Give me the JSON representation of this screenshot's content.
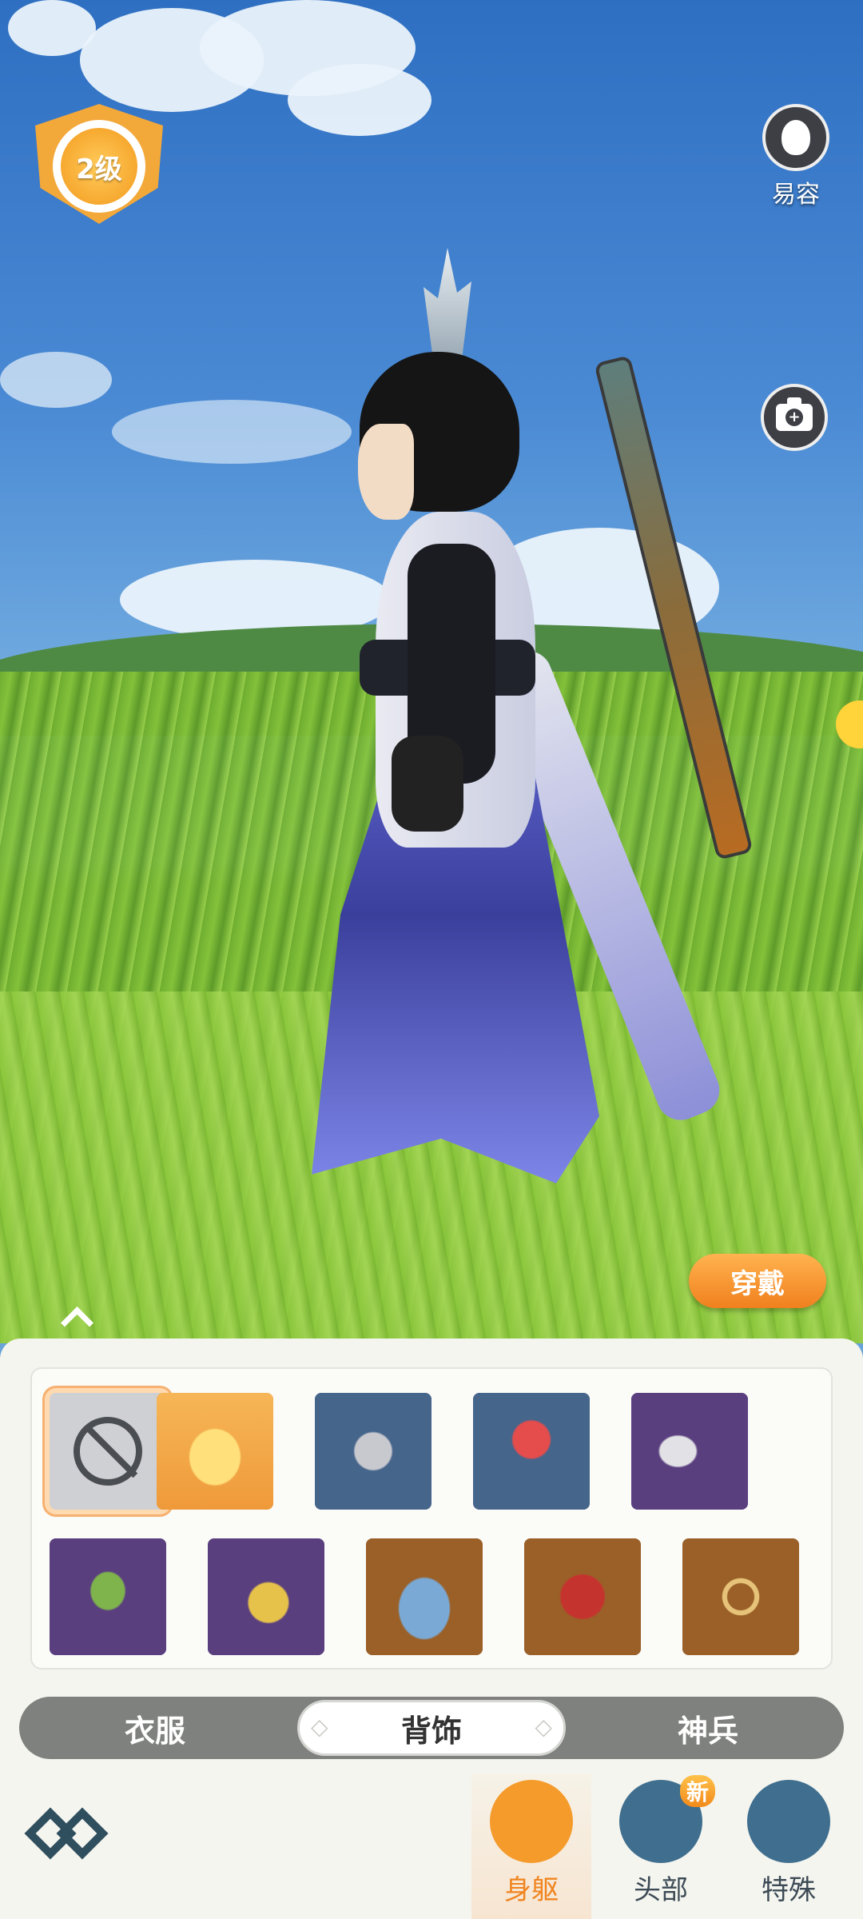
{
  "hud": {
    "level": "2级",
    "face_edit_label": "易容",
    "equip_button": "穿戴"
  },
  "items": [
    {
      "name": "none",
      "selected": true
    },
    {
      "name": "golden-dragon-statue",
      "bg": "#f0a24a"
    },
    {
      "name": "seal-plush",
      "bg": "#46658b"
    },
    {
      "name": "red-flower-lantern",
      "bg": "#46658b"
    },
    {
      "name": "curved-scythe",
      "bg": "#5a3f7f"
    },
    {
      "name": "green-herb-bundle",
      "bg": "#5a3f7f"
    },
    {
      "name": "yellow-gourd",
      "bg": "#5a3f7f"
    },
    {
      "name": "blue-cape",
      "bg": "#9a6028"
    },
    {
      "name": "red-wings",
      "bg": "#9a6028"
    },
    {
      "name": "golden-halo",
      "bg": "#9a6028"
    }
  ],
  "tabs": [
    {
      "label": "衣服",
      "active": false
    },
    {
      "label": "背饰",
      "active": true
    },
    {
      "label": "神兵",
      "active": false
    }
  ],
  "nav": [
    {
      "label": "身躯",
      "active": true,
      "icon": "torso-icon",
      "color": "#f59b2c"
    },
    {
      "label": "头部",
      "active": false,
      "icon": "head-icon",
      "color": "#3f6e8e",
      "badge": "新"
    },
    {
      "label": "特殊",
      "active": false,
      "icon": "special-icon",
      "color": "#3f6e8e"
    }
  ]
}
